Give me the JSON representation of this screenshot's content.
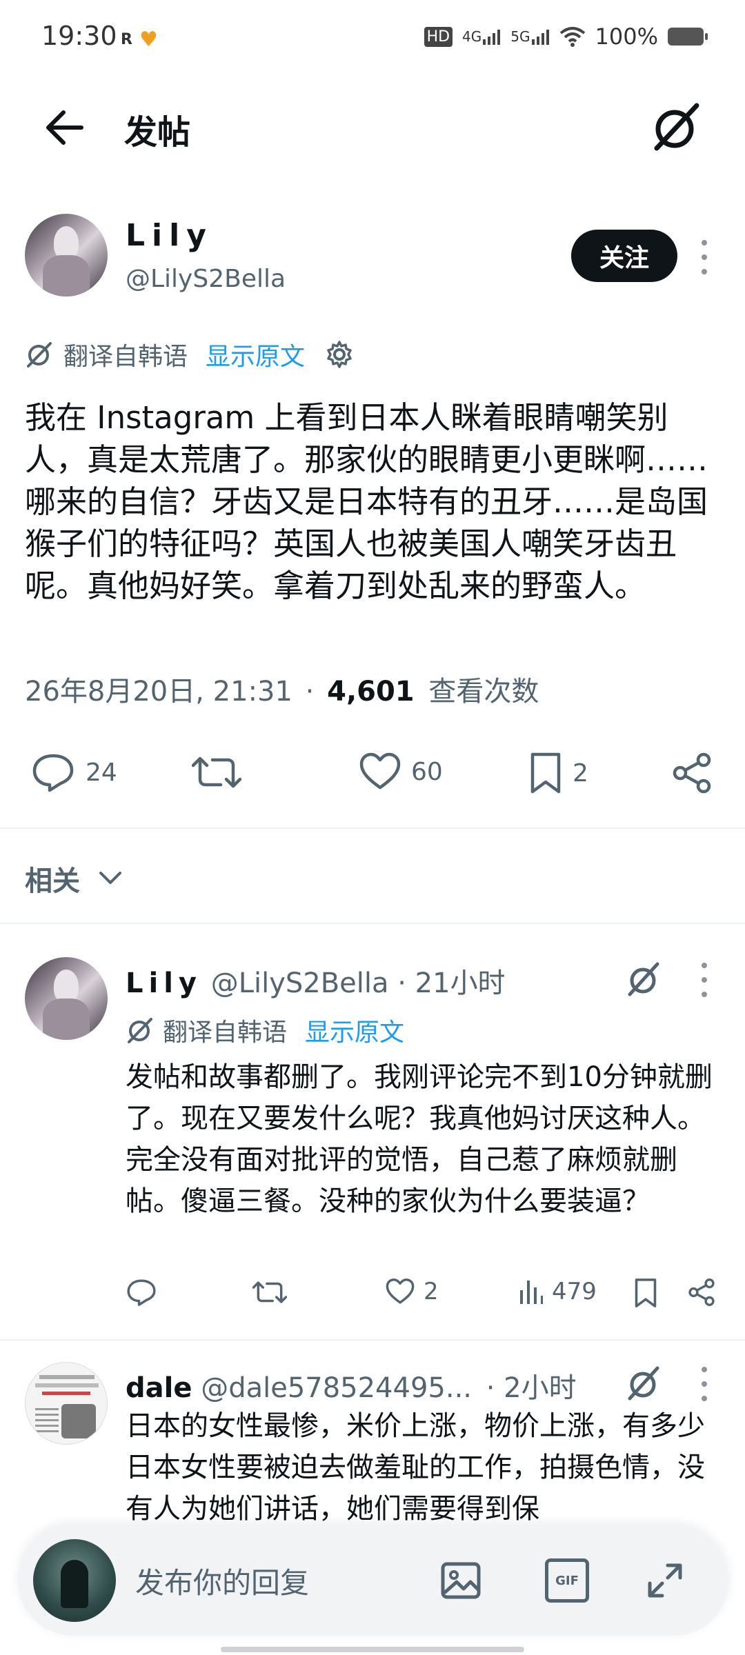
{
  "status_bar": {
    "time": "19:30",
    "left_icons": [
      "R",
      "♥"
    ],
    "hd_label": "HD",
    "signal1": "4G",
    "signal2": "5G",
    "battery": "100%"
  },
  "header": {
    "title": "发帖",
    "back_icon": "arrow-left-icon",
    "right_icon": "grok-icon"
  },
  "post": {
    "author_name": "Lily",
    "author_handle": "@LilyS2Bella",
    "follow_label": "关注",
    "translate_label": "翻译自韩语",
    "show_original_label": "显示原文",
    "text": "我在 Instagram 上看到日本人眯着眼睛嘲笑别人，真是太荒唐了。那家伙的眼睛更小更眯啊……哪来的自信？牙齿又是日本特有的丑牙……是岛国猴子们的特征吗？英国人也被美国人嘲笑牙齿丑呢。真他妈好笑。拿着刀到处乱来的野蛮人。",
    "timestamp": "26年8月20日, 21:31",
    "separator": "·",
    "views_count": "4,601",
    "views_label": "查看次数",
    "replies": "24",
    "likes": "60",
    "bookmarks": "2"
  },
  "related": {
    "label": "相关"
  },
  "replies": [
    {
      "name": "Lily",
      "handle": "@LilyS2Bella",
      "time": "· 21小时",
      "translate_label": "翻译自韩语",
      "show_original_label": "显示原文",
      "text": "发帖和故事都删了。我刚评论完不到10分钟就删了。现在又要发什么呢？我真他妈讨厌这种人。完全没有面对批评的觉悟，自己惹了麻烦就删帖。傻逼三餐。没种的家伙为什么要装逼？",
      "likes": "2",
      "views": "479"
    },
    {
      "name": "dale",
      "handle": "@dale578524495...",
      "time": "· 2小时",
      "text": "日本的女性最惨，米价上涨，物价上涨，有多少日本女性要被迫去做羞耻的工作，拍摄色情，没有人为她们讲话，她们需要得到保"
    }
  ],
  "composer": {
    "placeholder": "发布你的回复",
    "gif_label": "GIF"
  },
  "colors": {
    "accent": "#1d9bf0",
    "text": "#0f1419",
    "secondary": "#536471"
  }
}
